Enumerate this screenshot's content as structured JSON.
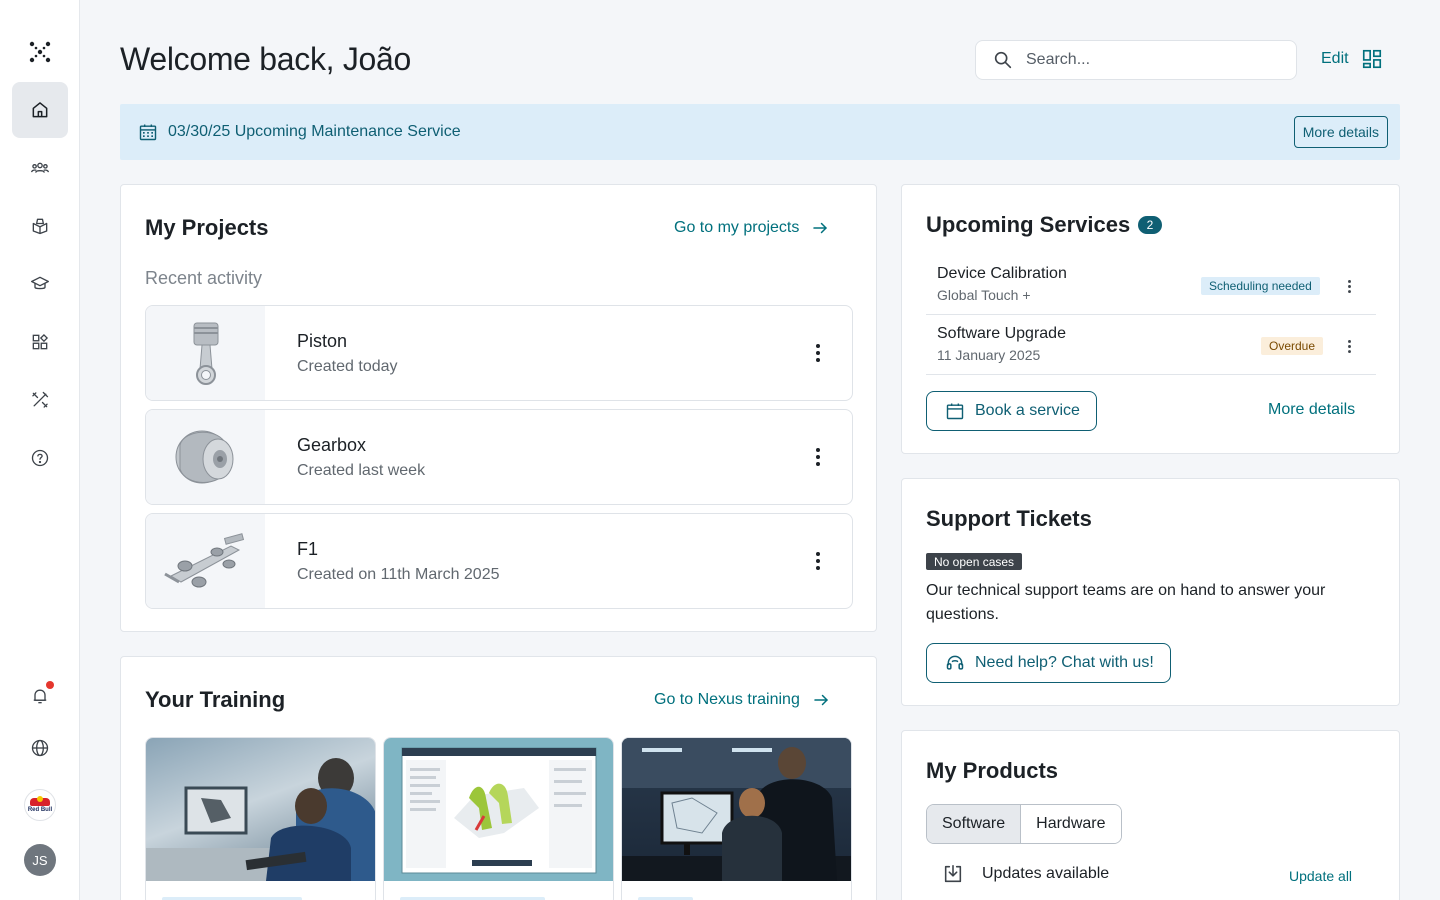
{
  "header": {
    "title": "Welcome back, João",
    "search_placeholder": "Search...",
    "edit_label": "Edit"
  },
  "banner": {
    "text": "03/30/25 Upcoming Maintenance Service",
    "button_label": "More details"
  },
  "sidebar": {
    "items": [
      {
        "icon": "home-icon",
        "active": true
      },
      {
        "icon": "users-icon"
      },
      {
        "icon": "box-icon"
      },
      {
        "icon": "graduation-cap-icon"
      },
      {
        "icon": "apps-icon"
      },
      {
        "icon": "tools-icon"
      },
      {
        "icon": "help-icon"
      }
    ],
    "bottom": {
      "notification_icon": "bell-icon",
      "globe_icon": "globe-icon",
      "org_logo_text": "Red Bull",
      "avatar_initials": "JS"
    }
  },
  "projects": {
    "title": "My Projects",
    "link_label": "Go to my projects",
    "recent_label": "Recent activity",
    "items": [
      {
        "name": "Piston",
        "subtitle": "Created today"
      },
      {
        "name": "Gearbox",
        "subtitle": "Created last week"
      },
      {
        "name": "F1",
        "subtitle": "Created on 11th March 2025"
      }
    ]
  },
  "training": {
    "title": "Your Training",
    "link_label": "Go to Nexus training"
  },
  "services": {
    "title": "Upcoming Services",
    "count": "2",
    "items": [
      {
        "name": "Device Calibration",
        "subtitle": "Global Touch +",
        "status": "Scheduling needed"
      },
      {
        "name": "Software Upgrade",
        "subtitle": "11 January 2025",
        "status": "Overdue"
      }
    ],
    "book_label": "Book a service",
    "details_label": "More details"
  },
  "support": {
    "title": "Support Tickets",
    "badge": "No open cases",
    "text": "Our technical support teams are on hand to answer your questions.",
    "chat_label": "Need help? Chat with us!"
  },
  "products": {
    "title": "My Products",
    "tabs": [
      "Software",
      "Hardware"
    ],
    "active_tab": "Software",
    "updates_label": "Updates available",
    "update_all_label": "Update all"
  },
  "colors": {
    "accent": "#00707d",
    "banner_bg": "#dcedf9",
    "badge_dark": "#0f5f73",
    "notification_dot": "#e5362d"
  }
}
